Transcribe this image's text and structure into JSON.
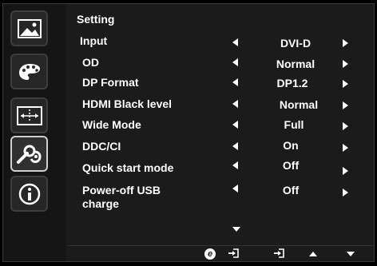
{
  "menu": {
    "title": "Setting",
    "rows": [
      {
        "label": "Input",
        "value": "DVI-D"
      },
      {
        "label": "OD",
        "value": "Normal"
      },
      {
        "label": "DP Format",
        "value": "DP1.2"
      },
      {
        "label": "HDMI Black level",
        "value": "Normal"
      },
      {
        "label": "Wide Mode",
        "value": "Full"
      },
      {
        "label": "DDC/CI",
        "value": "On"
      },
      {
        "label": "Quick start mode",
        "value": "Off"
      },
      {
        "label": "Power-off USB charge",
        "value": "Off"
      }
    ]
  },
  "sidebar": {
    "items": [
      {
        "icon": "picture-icon"
      },
      {
        "icon": "palette-icon"
      },
      {
        "icon": "screen-position-icon"
      },
      {
        "icon": "settings-wrench-icon",
        "active": true
      },
      {
        "icon": "info-icon"
      }
    ]
  },
  "footer": {
    "buttons": [
      {
        "icon": "e-key-icon",
        "text": "e"
      },
      {
        "icon": "enter-icon"
      },
      {
        "icon": "enter-icon"
      },
      {
        "icon": "up-arrow-icon"
      },
      {
        "icon": "down-arrow-icon"
      }
    ]
  }
}
